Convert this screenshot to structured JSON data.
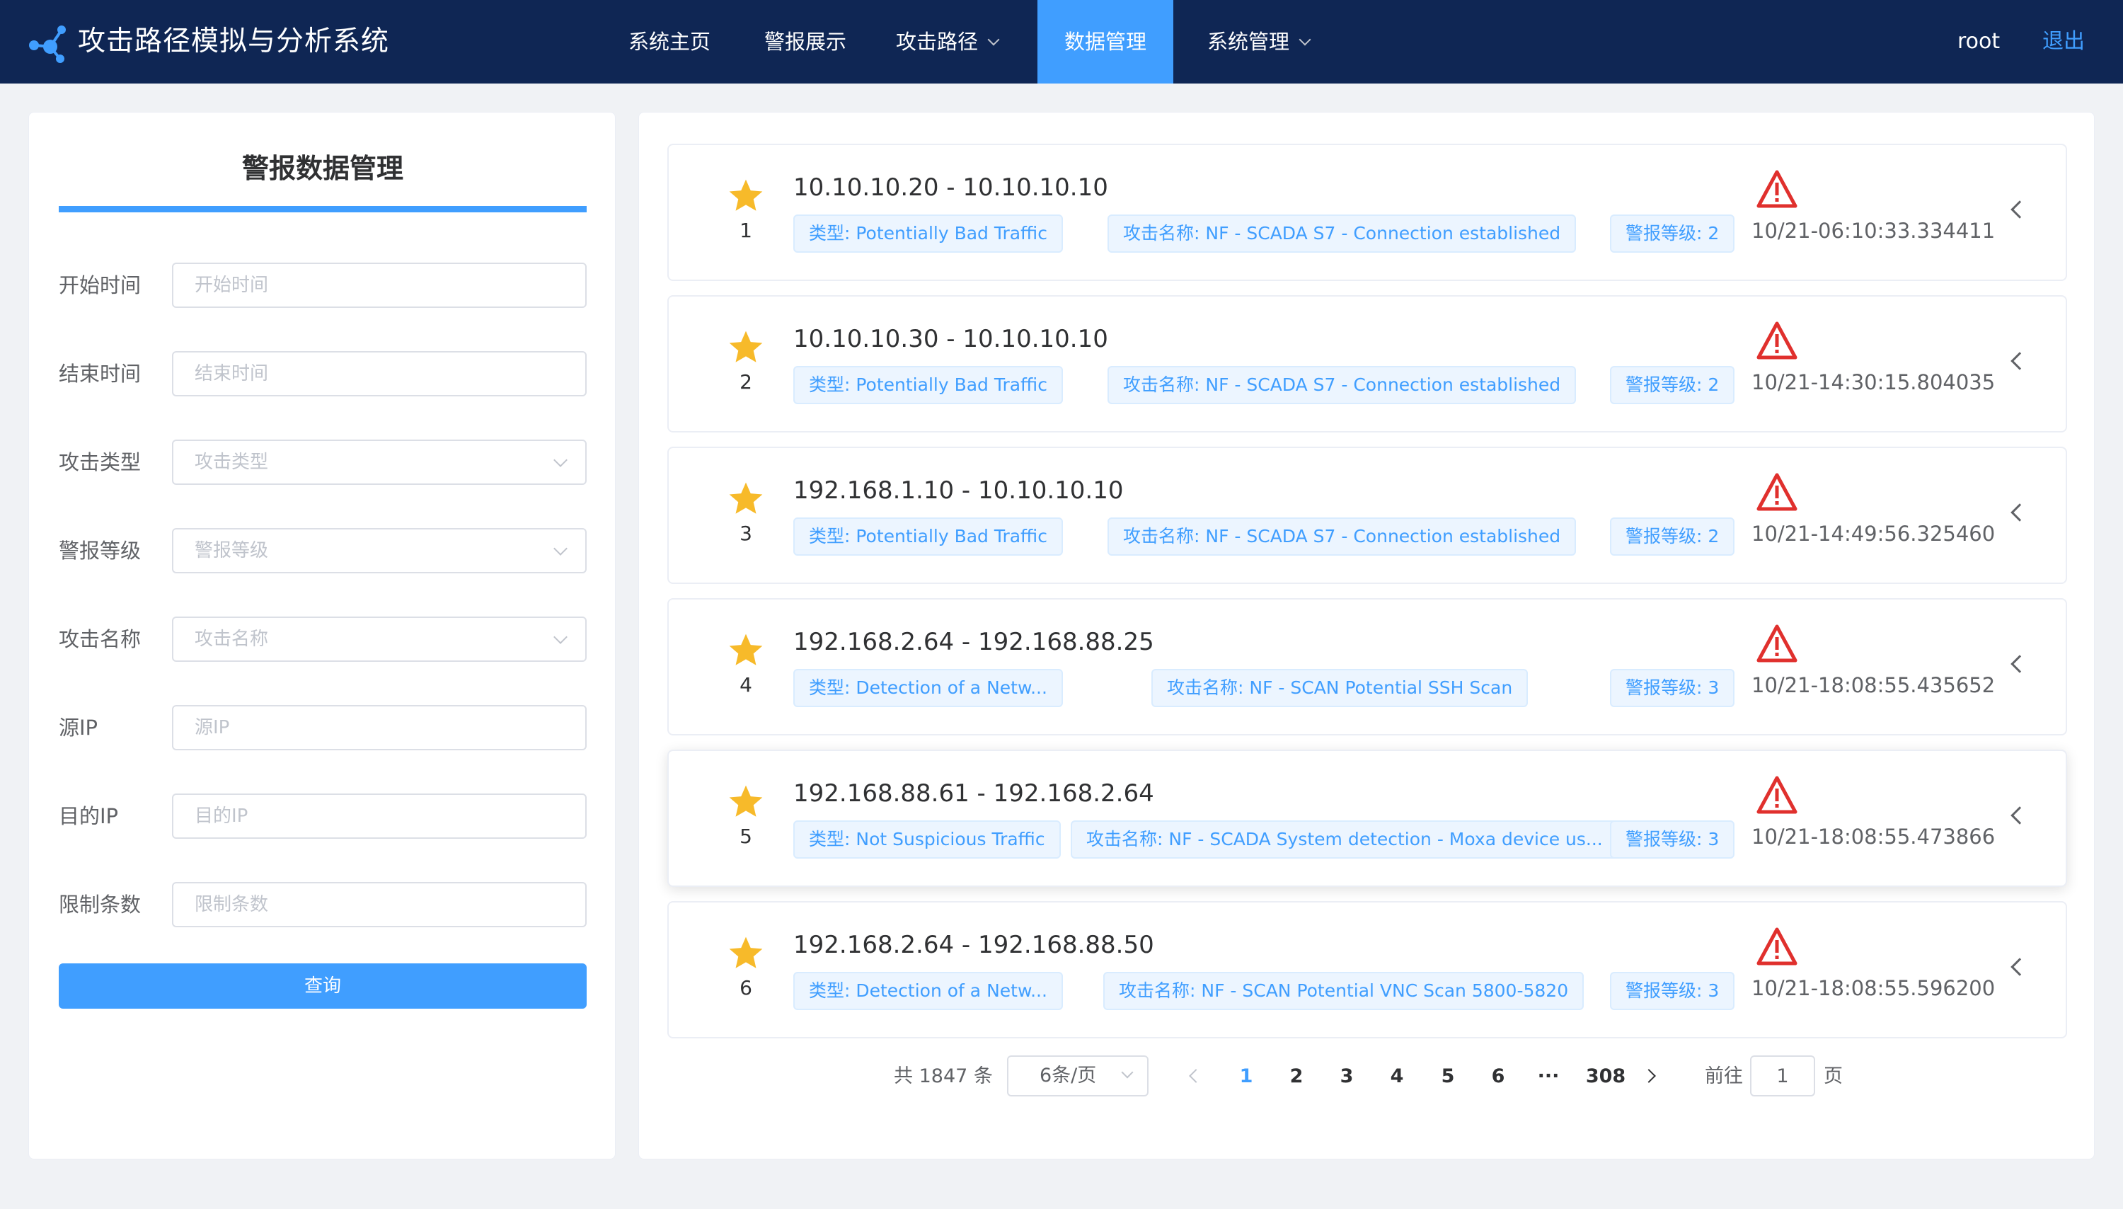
{
  "header": {
    "app_title": "攻击路径模拟与分析系统",
    "logo_icon": "network-nodes-icon",
    "nav": [
      {
        "label": "系统主页",
        "dropdown": false,
        "active": false
      },
      {
        "label": "警报展示",
        "dropdown": false,
        "active": false
      },
      {
        "label": "攻击路径",
        "dropdown": true,
        "active": false
      },
      {
        "label": "数据管理",
        "dropdown": false,
        "active": true
      },
      {
        "label": "系统管理",
        "dropdown": true,
        "active": false
      }
    ],
    "user": "root",
    "logout": "退出"
  },
  "filter_panel": {
    "title": "警报数据管理",
    "fields": [
      {
        "label": "开始时间",
        "placeholder": "开始时间",
        "type": "input"
      },
      {
        "label": "结束时间",
        "placeholder": "结束时间",
        "type": "input"
      },
      {
        "label": "攻击类型",
        "placeholder": "攻击类型",
        "type": "select"
      },
      {
        "label": "警报等级",
        "placeholder": "警报等级",
        "type": "select"
      },
      {
        "label": "攻击名称",
        "placeholder": "攻击名称",
        "type": "select"
      },
      {
        "label": "源IP",
        "placeholder": "源IP",
        "type": "input"
      },
      {
        "label": "目的IP",
        "placeholder": "目的IP",
        "type": "input"
      },
      {
        "label": "限制条数",
        "placeholder": "限制条数",
        "type": "input"
      }
    ],
    "query_button": "查询"
  },
  "alerts": [
    {
      "index": "1",
      "ip": "10.10.10.20 - 10.10.10.10",
      "type": "类型: Potentially Bad Traffic",
      "name": "攻击名称: NF - SCADA S7 - Connection established",
      "level": "警报等级: 2",
      "time": "10/21-06:10:33.334411"
    },
    {
      "index": "2",
      "ip": "10.10.10.30 - 10.10.10.10",
      "type": "类型: Potentially Bad Traffic",
      "name": "攻击名称: NF - SCADA S7 - Connection established",
      "level": "警报等级: 2",
      "time": "10/21-14:30:15.804035"
    },
    {
      "index": "3",
      "ip": "192.168.1.10 - 10.10.10.10",
      "type": "类型: Potentially Bad Traffic",
      "name": "攻击名称: NF - SCADA S7 - Connection established",
      "level": "警报等级: 2",
      "time": "10/21-14:49:56.325460"
    },
    {
      "index": "4",
      "ip": "192.168.2.64 - 192.168.88.25",
      "type": "类型: Detection of a Netw...",
      "name": "攻击名称: NF - SCAN Potential SSH Scan",
      "level": "警报等级: 3",
      "time": "10/21-18:08:55.435652"
    },
    {
      "index": "5",
      "ip": "192.168.88.61 - 192.168.2.64",
      "type": "类型: Not Suspicious Traffic",
      "name": "攻击名称: NF - SCADA System detection - Moxa device us...",
      "level": "警报等级: 3",
      "time": "10/21-18:08:55.473866"
    },
    {
      "index": "6",
      "ip": "192.168.2.64 - 192.168.88.50",
      "type": "类型: Detection of a Netw...",
      "name": "攻击名称: NF - SCAN Potential VNC Scan 5800-5820",
      "level": "警报等级: 3",
      "time": "10/21-18:08:55.596200"
    }
  ],
  "pagination": {
    "total": "共 1847 条",
    "page_size": "6条/页",
    "pages": [
      "1",
      "2",
      "3",
      "4",
      "5",
      "6",
      "···",
      "308"
    ],
    "current": "1",
    "goto_label": "前往",
    "goto_value": "1",
    "page_suffix": "页"
  },
  "colors": {
    "header_bg": "#0f2654",
    "accent": "#409eff",
    "star": "#f7ba2a",
    "warning": "#e0302d"
  }
}
